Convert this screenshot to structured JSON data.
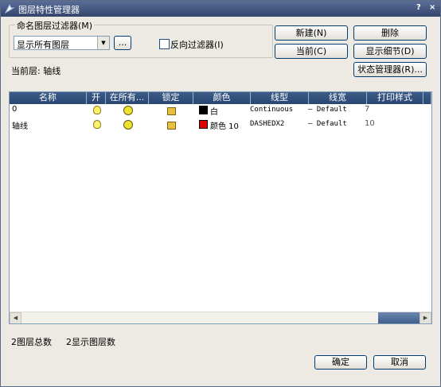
{
  "window": {
    "title": "图层特性管理器",
    "help_glyph": "?",
    "close_glyph": "×"
  },
  "filter": {
    "group_title": "命名图层过滤器(M)",
    "selected": "显示所有图层",
    "browse_label": "...",
    "invert_label": "反向过滤器(I)",
    "invert_checked": false
  },
  "buttons": {
    "new": "新建(N)",
    "delete": "删除",
    "current": "当前(C)",
    "show_details": "显示细节(D)",
    "state_manager": "状态管理器(R)...",
    "ok": "确定",
    "cancel": "取消"
  },
  "current_layer": "当前层: 轴线",
  "table": {
    "columns": [
      "名称",
      "开",
      "在所有...",
      "锁定",
      "颜色",
      "线型",
      "线宽",
      "打印样式"
    ],
    "rows": [
      {
        "name": "0",
        "on": "bulb-on-icon",
        "frozen": "sun-icon",
        "locked": "unlock-icon",
        "color_hex": "#000000",
        "color_label": "白",
        "linetype": "Continuous",
        "lineweight": "— Default",
        "plot_style": "7"
      },
      {
        "name": "轴线",
        "on": "bulb-on-icon",
        "frozen": "sun-icon",
        "locked": "unlock-icon",
        "color_hex": "#e00000",
        "color_label": "颜色 10",
        "linetype": "DASHEDX2",
        "lineweight": "— Default",
        "plot_style": "10"
      }
    ]
  },
  "status": {
    "total": "2图层总数",
    "shown": "2显示图层数"
  },
  "colors": {
    "title_bar": "#33456b",
    "header": "#2a4672",
    "accent": "#003c74"
  }
}
